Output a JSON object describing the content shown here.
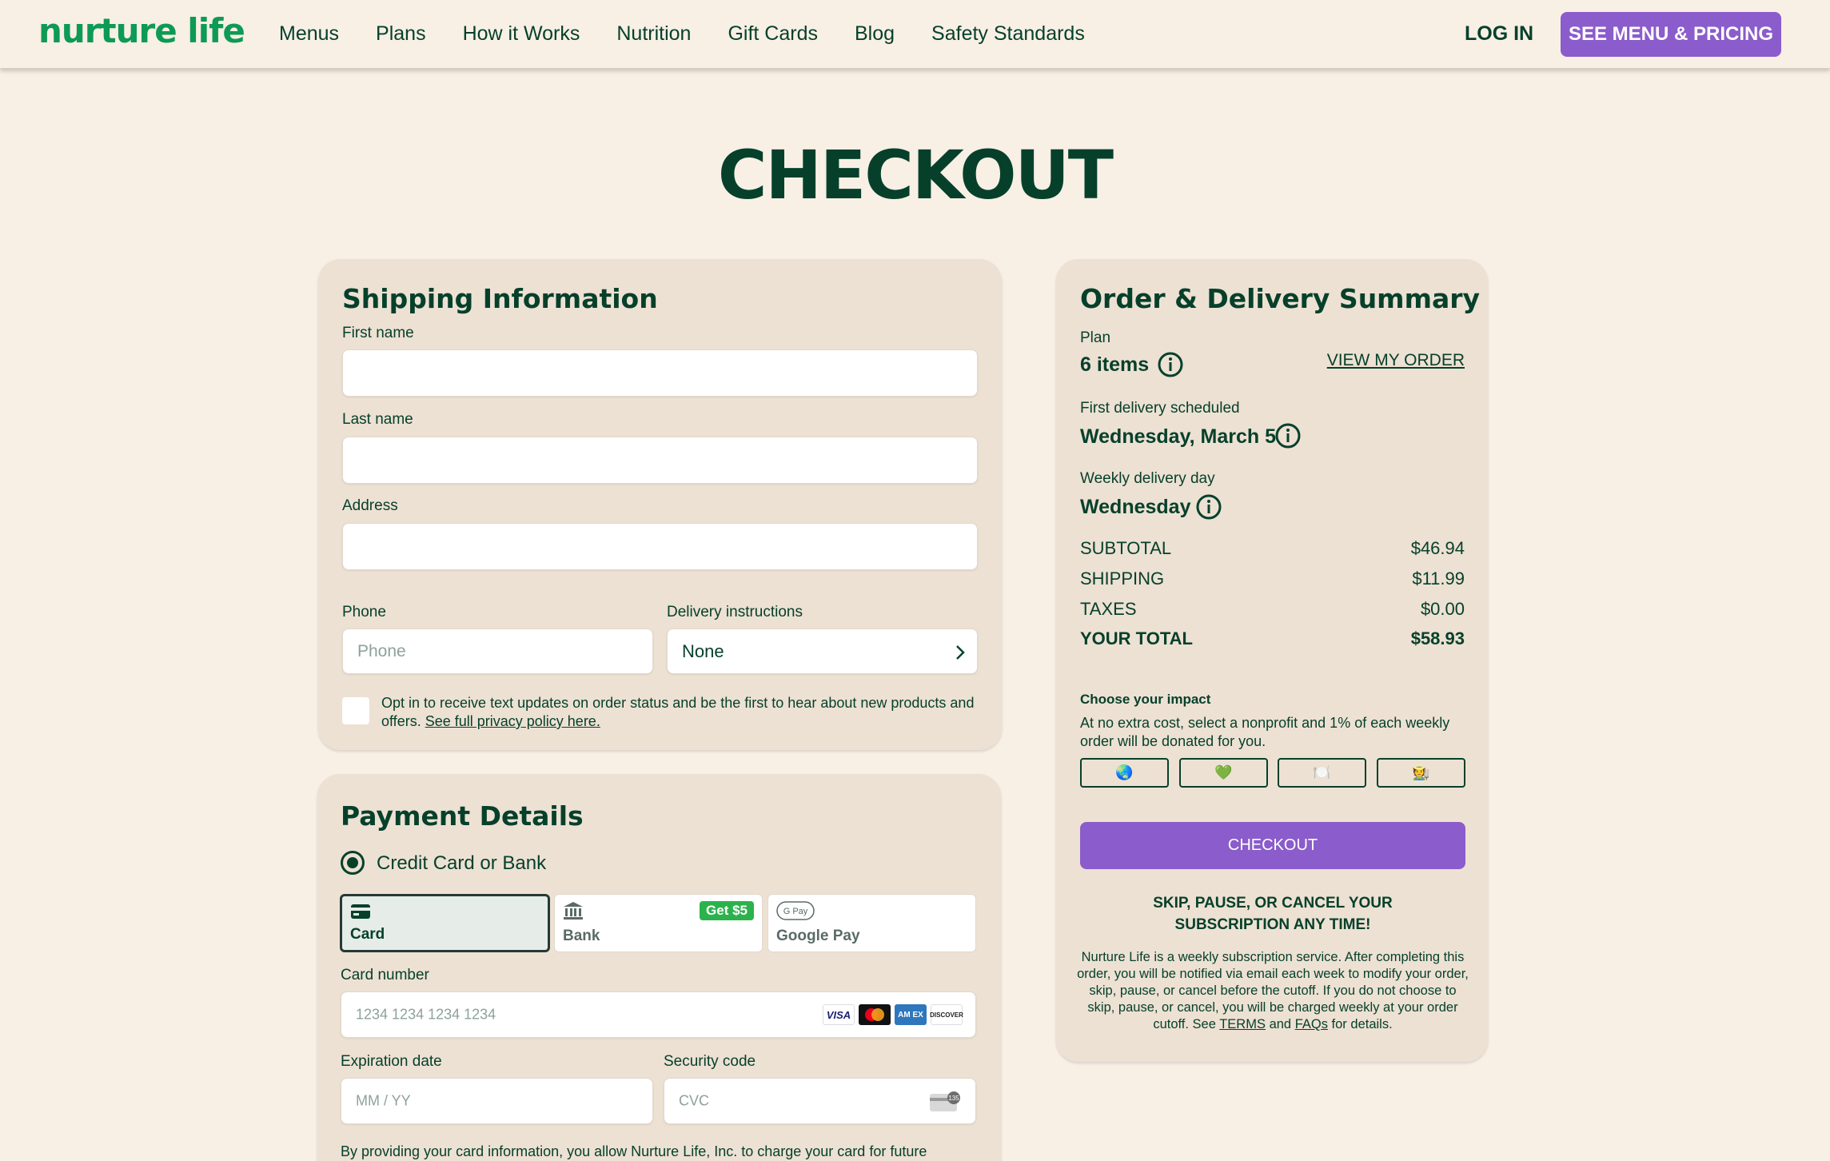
{
  "header": {
    "logo": "nurture life",
    "nav": [
      "Menus",
      "Plans",
      "How it Works",
      "Nutrition",
      "Gift Cards",
      "Blog",
      "Safety Standards"
    ],
    "login": "LOG IN",
    "cta": "SEE MENU & PRICING"
  },
  "page_title": "CHECKOUT",
  "shipping": {
    "title": "Shipping Information",
    "first_name_label": "First name",
    "last_name_label": "Last name",
    "address_label": "Address",
    "phone_label": "Phone",
    "phone_placeholder": "Phone",
    "delivery_label": "Delivery instructions",
    "delivery_value": "None",
    "optin_text": "Opt in to receive text updates on order status and be the first to hear about new products and offers.",
    "optin_link": "See full privacy policy here."
  },
  "payment": {
    "title": "Payment Details",
    "method_label": "Credit Card or Bank",
    "tabs": [
      {
        "label": "Card",
        "icon": "card-icon",
        "selected": true
      },
      {
        "label": "Bank",
        "icon": "bank-icon",
        "badge": "Get $5"
      },
      {
        "label": "Google Pay",
        "icon": "google-pay-icon"
      }
    ],
    "card_number_label": "Card number",
    "card_number_placeholder": "1234 1234 1234 1234",
    "brands": [
      "VISA",
      "Mastercard",
      "AMEX",
      "DISCOVER"
    ],
    "expiration_label": "Expiration date",
    "expiration_placeholder": "MM / YY",
    "security_label": "Security code",
    "security_placeholder": "CVC",
    "disclaimer": "By providing your card information, you allow Nurture Life, Inc. to charge your card for future"
  },
  "summary": {
    "title": "Order & Delivery Summary",
    "plan_label": "Plan",
    "plan_value": "6 items",
    "view_order": "VIEW MY ORDER",
    "first_delivery_label": "First delivery scheduled",
    "first_delivery_value": "Wednesday, March 5",
    "weekly_day_label": "Weekly delivery day",
    "weekly_day_value": "Wednesday",
    "rows": [
      {
        "label": "SUBTOTAL",
        "value": "$46.94"
      },
      {
        "label": "SHIPPING",
        "value": "$11.99"
      },
      {
        "label": "TAXES",
        "value": "$0.00"
      },
      {
        "label": "YOUR TOTAL",
        "value": "$58.93"
      }
    ],
    "impact_title": "Choose your impact",
    "impact_desc": "At no extra cost, select a nonprofit and 1% of each weekly order will be donated for you.",
    "impact_options": [
      "🌏",
      "💚",
      "🍽️",
      "🧑‍🌾"
    ],
    "checkout_button": "CHECKOUT",
    "skip_line1": "SKIP, PAUSE, OR CANCEL YOUR",
    "skip_line2": "SUBSCRIPTION ANY TIME!",
    "legal_text": "Nurture Life is a weekly subscription service. After completing this order, you will be notified via email each week to modify your order, skip, pause, or cancel before the cutoff. If you do not choose to skip, pause, or cancel, you will be charged weekly at your order cutoff. See",
    "legal_terms": "TERMS",
    "legal_and": "and",
    "legal_faqs": "FAQs",
    "legal_end": "for details."
  },
  "colors": {
    "background": "#f8efe5",
    "card": "#ede1d3",
    "brand_green": "#0d9a55",
    "text_dark_green": "#06402b",
    "accent_purple": "#8b5ccb"
  }
}
